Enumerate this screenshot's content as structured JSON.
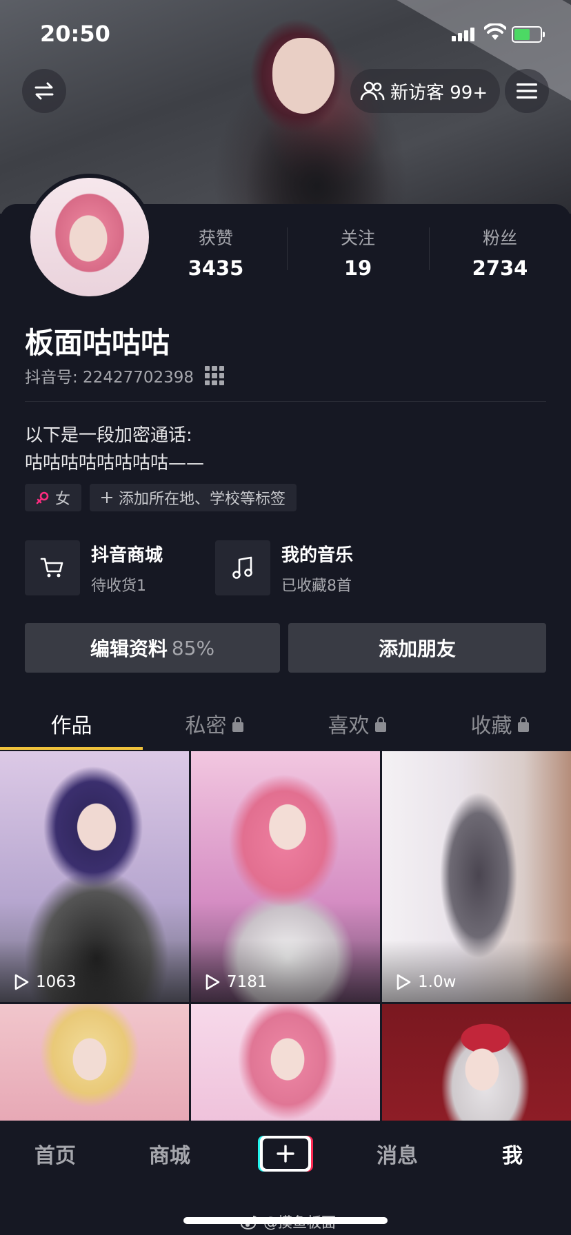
{
  "status_bar": {
    "time": "20:50"
  },
  "header": {
    "visitor_label": "新访客 99+"
  },
  "profile": {
    "name": "板面咕咕咕",
    "douyin_id": "抖音号: 22427702398",
    "bio_line1": "以下是一段加密通话:",
    "bio_line2": "咕咕咕咕咕咕咕咕——",
    "gender_tag": "女",
    "add_tag": "添加所在地、学校等标签"
  },
  "stats": [
    {
      "label": "获赞",
      "value": "3435"
    },
    {
      "label": "关注",
      "value": "19"
    },
    {
      "label": "粉丝",
      "value": "2734"
    }
  ],
  "services": [
    {
      "title": "抖音商城",
      "subtitle": "待收货1",
      "icon": "cart-icon"
    },
    {
      "title": "我的音乐",
      "subtitle": "已收藏8首",
      "icon": "music-note-icon"
    }
  ],
  "buttons": {
    "edit_label": "编辑资料",
    "edit_percent": "85%",
    "add_friend": "添加朋友"
  },
  "tabs": [
    {
      "label": "作品",
      "locked": false,
      "active": true
    },
    {
      "label": "私密",
      "locked": true,
      "active": false
    },
    {
      "label": "喜欢",
      "locked": true,
      "active": false
    },
    {
      "label": "收藏",
      "locked": true,
      "active": false
    }
  ],
  "videos": [
    {
      "plays": "1063"
    },
    {
      "plays": "7181"
    },
    {
      "plays": "1.0w"
    },
    {
      "plays": ""
    },
    {
      "plays": ""
    },
    {
      "plays": ""
    }
  ],
  "bottom_nav": [
    {
      "label": "首页",
      "active": false
    },
    {
      "label": "商城",
      "active": false
    },
    {
      "label": "消息",
      "active": false
    },
    {
      "label": "我",
      "active": true
    }
  ],
  "watermark": "@摸鱼板面",
  "colors": {
    "background": "#161823",
    "tab_indicator": "#f0c23c",
    "gender_icon": "#fe2c80"
  }
}
